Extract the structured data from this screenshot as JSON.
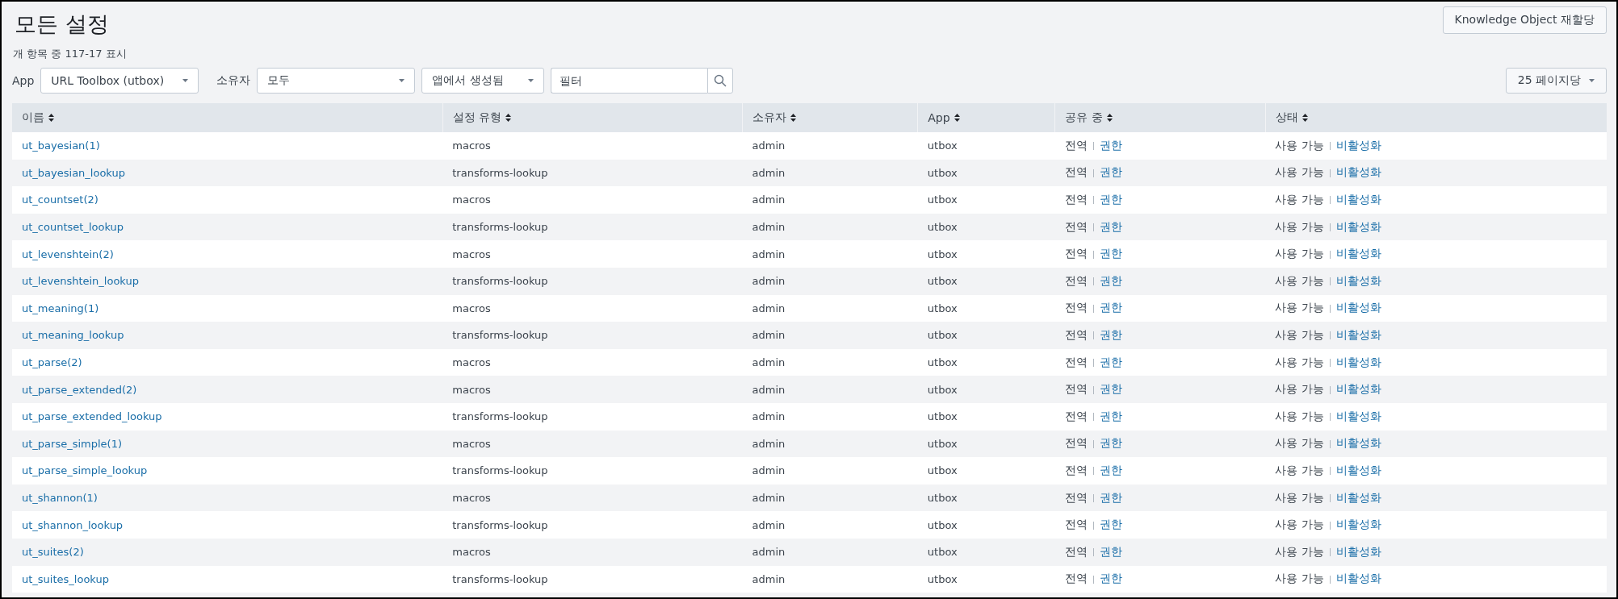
{
  "page": {
    "title": "모든 설정",
    "count_text": "개 항목 중 117-17 표시",
    "reassign_button": "Knowledge Object 재할당"
  },
  "filters": {
    "app_label": "App",
    "app_value": "URL Toolbox (utbox)",
    "owner_label": "소유자",
    "owner_value": "모두",
    "created_value": "앱에서 생성됨",
    "search_placeholder": "필터",
    "per_page": "25 페이지당"
  },
  "table": {
    "columns": [
      "이름",
      "설정 유형",
      "소유자",
      "App",
      "공유 중",
      "상태"
    ],
    "rows": [
      {
        "name": "ut_bayesian(1)",
        "type": "macros",
        "owner": "admin",
        "app": "utbox",
        "sharing": "전역",
        "sharing_link": "권한",
        "status": "사용 가능",
        "status_link": "비활성화"
      },
      {
        "name": "ut_bayesian_lookup",
        "type": "transforms-lookup",
        "owner": "admin",
        "app": "utbox",
        "sharing": "전역",
        "sharing_link": "권한",
        "status": "사용 가능",
        "status_link": "비활성화"
      },
      {
        "name": "ut_countset(2)",
        "type": "macros",
        "owner": "admin",
        "app": "utbox",
        "sharing": "전역",
        "sharing_link": "권한",
        "status": "사용 가능",
        "status_link": "비활성화"
      },
      {
        "name": "ut_countset_lookup",
        "type": "transforms-lookup",
        "owner": "admin",
        "app": "utbox",
        "sharing": "전역",
        "sharing_link": "권한",
        "status": "사용 가능",
        "status_link": "비활성화"
      },
      {
        "name": "ut_levenshtein(2)",
        "type": "macros",
        "owner": "admin",
        "app": "utbox",
        "sharing": "전역",
        "sharing_link": "권한",
        "status": "사용 가능",
        "status_link": "비활성화"
      },
      {
        "name": "ut_levenshtein_lookup",
        "type": "transforms-lookup",
        "owner": "admin",
        "app": "utbox",
        "sharing": "전역",
        "sharing_link": "권한",
        "status": "사용 가능",
        "status_link": "비활성화"
      },
      {
        "name": "ut_meaning(1)",
        "type": "macros",
        "owner": "admin",
        "app": "utbox",
        "sharing": "전역",
        "sharing_link": "권한",
        "status": "사용 가능",
        "status_link": "비활성화"
      },
      {
        "name": "ut_meaning_lookup",
        "type": "transforms-lookup",
        "owner": "admin",
        "app": "utbox",
        "sharing": "전역",
        "sharing_link": "권한",
        "status": "사용 가능",
        "status_link": "비활성화"
      },
      {
        "name": "ut_parse(2)",
        "type": "macros",
        "owner": "admin",
        "app": "utbox",
        "sharing": "전역",
        "sharing_link": "권한",
        "status": "사용 가능",
        "status_link": "비활성화"
      },
      {
        "name": "ut_parse_extended(2)",
        "type": "macros",
        "owner": "admin",
        "app": "utbox",
        "sharing": "전역",
        "sharing_link": "권한",
        "status": "사용 가능",
        "status_link": "비활성화"
      },
      {
        "name": "ut_parse_extended_lookup",
        "type": "transforms-lookup",
        "owner": "admin",
        "app": "utbox",
        "sharing": "전역",
        "sharing_link": "권한",
        "status": "사용 가능",
        "status_link": "비활성화"
      },
      {
        "name": "ut_parse_simple(1)",
        "type": "macros",
        "owner": "admin",
        "app": "utbox",
        "sharing": "전역",
        "sharing_link": "권한",
        "status": "사용 가능",
        "status_link": "비활성화"
      },
      {
        "name": "ut_parse_simple_lookup",
        "type": "transforms-lookup",
        "owner": "admin",
        "app": "utbox",
        "sharing": "전역",
        "sharing_link": "권한",
        "status": "사용 가능",
        "status_link": "비활성화"
      },
      {
        "name": "ut_shannon(1)",
        "type": "macros",
        "owner": "admin",
        "app": "utbox",
        "sharing": "전역",
        "sharing_link": "권한",
        "status": "사용 가능",
        "status_link": "비활성화"
      },
      {
        "name": "ut_shannon_lookup",
        "type": "transforms-lookup",
        "owner": "admin",
        "app": "utbox",
        "sharing": "전역",
        "sharing_link": "권한",
        "status": "사용 가능",
        "status_link": "비활성화"
      },
      {
        "name": "ut_suites(2)",
        "type": "macros",
        "owner": "admin",
        "app": "utbox",
        "sharing": "전역",
        "sharing_link": "권한",
        "status": "사용 가능",
        "status_link": "비활성화"
      },
      {
        "name": "ut_suites_lookup",
        "type": "transforms-lookup",
        "owner": "admin",
        "app": "utbox",
        "sharing": "전역",
        "sharing_link": "권한",
        "status": "사용 가능",
        "status_link": "비활성화"
      }
    ]
  }
}
